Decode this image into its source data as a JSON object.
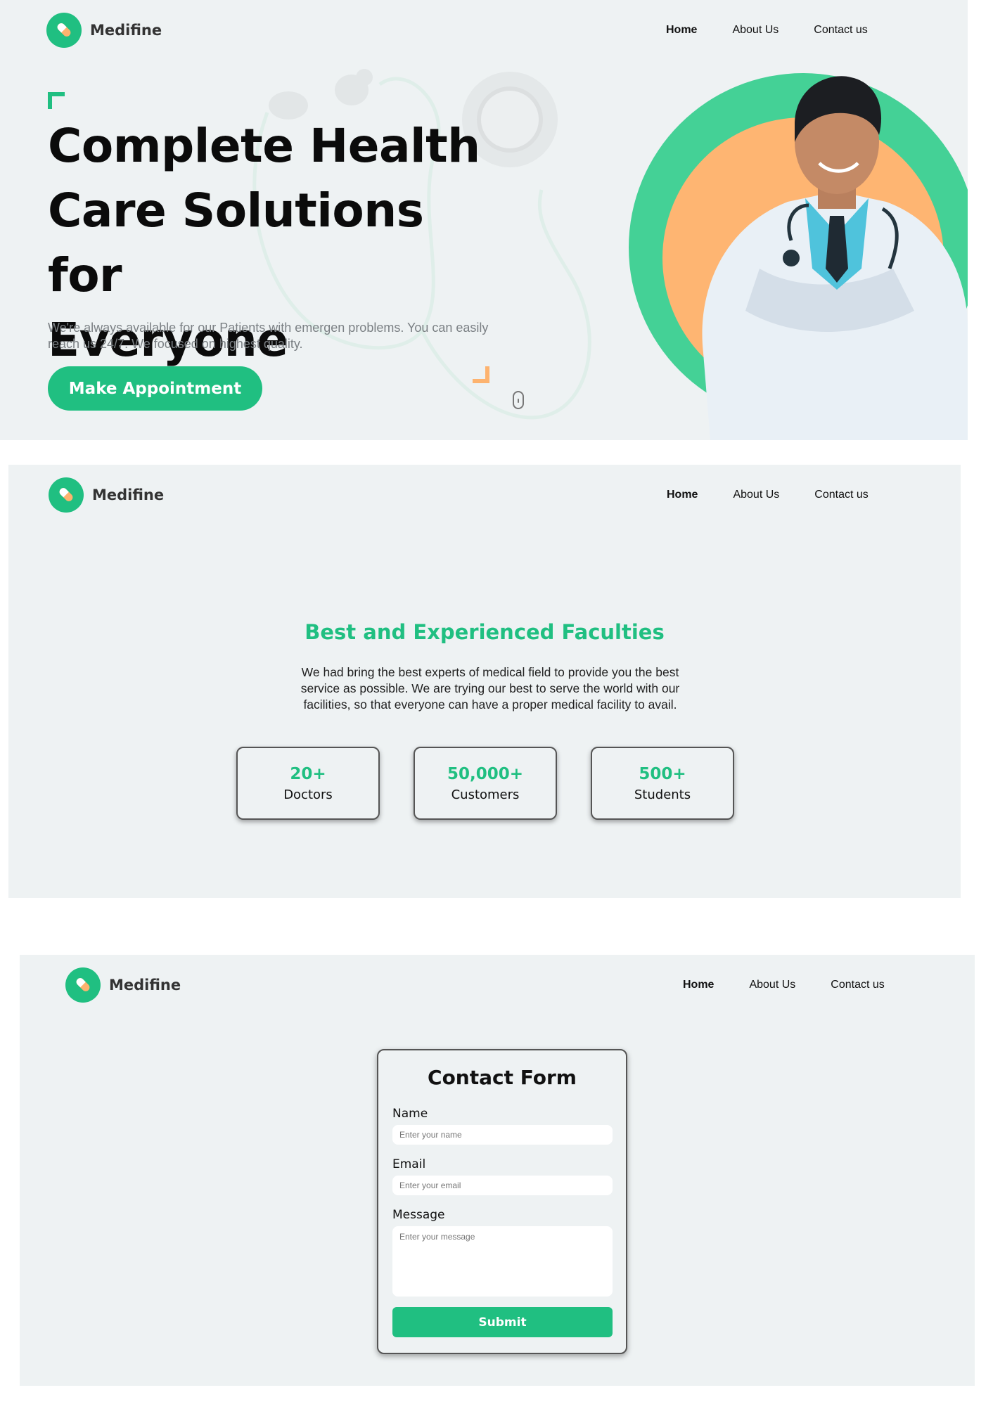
{
  "brand": {
    "name": "Medifine",
    "color": "#20bf81",
    "accent": "#fdb36f",
    "logo_icon": "pill-icon"
  },
  "nav": {
    "home": "Home",
    "about": "About Us",
    "contact": "Contact us"
  },
  "hero": {
    "title_line1": "Complete Health",
    "title_line2": "Care Solutions for",
    "title_line3": "Everyone",
    "subtitle": "We're always available for our Patients with emergen problems. You can easily reach us 24/7. We focused on highest quality.",
    "cta_label": "Make Appointment",
    "scroll_icon": "mouse-icon",
    "image": "doctor-portrait"
  },
  "faculties": {
    "title": "Best and Experienced Faculties",
    "text": "We had bring the best experts of medical field to provide you the best service as possible. We are trying our best to serve the world with our facilities, so that everyone can have a proper medical facility to avail.",
    "stats": [
      {
        "value": "20+",
        "label": "Doctors"
      },
      {
        "value": "50,000+",
        "label": "Customers"
      },
      {
        "value": "500+",
        "label": "Students"
      }
    ]
  },
  "contact_form": {
    "title": "Contact Form",
    "name_label": "Name",
    "name_placeholder": "Enter your name",
    "email_label": "Email",
    "email_placeholder": "Enter your email",
    "message_label": "Message",
    "message_placeholder": "Enter your message",
    "submit_label": "Submit"
  }
}
